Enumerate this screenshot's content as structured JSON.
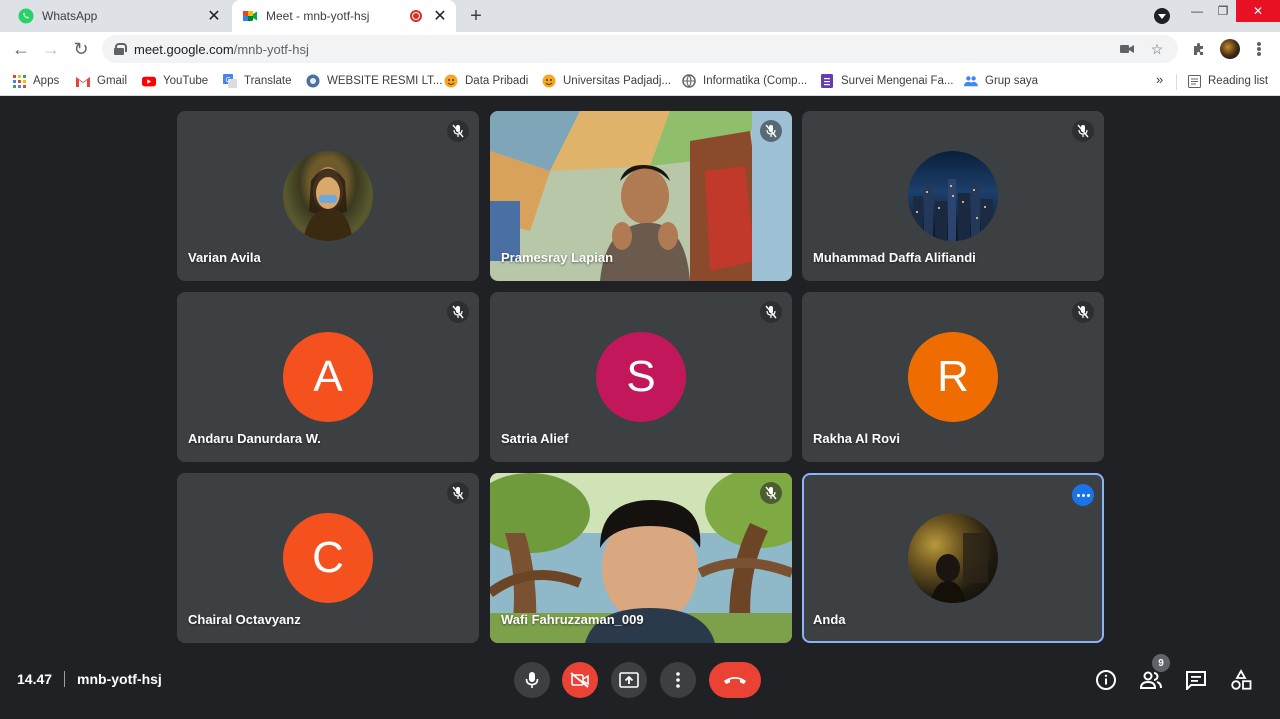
{
  "browser": {
    "tabs": [
      {
        "title": "WhatsApp",
        "icon": "whatsapp-icon",
        "active": false
      },
      {
        "title": "Meet - mnb-yotf-hsj",
        "icon": "google-meet-icon",
        "active": true,
        "recording": true
      }
    ],
    "url_host": "meet.google.com",
    "url_path": "/mnb-yotf-hsj",
    "bookmarks": [
      {
        "label": "Apps",
        "icon": "apps-grid-icon"
      },
      {
        "label": "Gmail",
        "icon": "gmail-icon"
      },
      {
        "label": "YouTube",
        "icon": "youtube-icon"
      },
      {
        "label": "Translate",
        "icon": "translate-icon"
      },
      {
        "label": "WEBSITE RESMI LT...",
        "icon": "globe-icon"
      },
      {
        "label": "Data Pribadi",
        "icon": "emoji-icon"
      },
      {
        "label": "Universitas Padjadj...",
        "icon": "emoji-icon"
      },
      {
        "label": "Informatika (Comp...",
        "icon": "globe-icon"
      },
      {
        "label": "Survei Mengenai Fa...",
        "icon": "forms-icon"
      },
      {
        "label": "Grup saya",
        "icon": "group-icon"
      }
    ],
    "more_bookmarks": "»",
    "reading_list": "Reading list"
  },
  "meet": {
    "time": "14.47",
    "meeting_code": "mnb-yotf-hsj",
    "participant_count": "9",
    "participants": [
      {
        "name": "Varian Avila",
        "type": "photo",
        "muted": true
      },
      {
        "name": "Pramesray Lapian",
        "type": "video",
        "muted": true
      },
      {
        "name": "Muhammad Daffa Alifiandi",
        "type": "photo",
        "muted": true
      },
      {
        "name": "Andaru Danurdara W.",
        "type": "initial",
        "initial": "A",
        "color": "#f4511e",
        "muted": true
      },
      {
        "name": "Satria Alief",
        "type": "initial",
        "initial": "S",
        "color": "#c2185b",
        "muted": true
      },
      {
        "name": "Rakha Al Rovi",
        "type": "initial",
        "initial": "R",
        "color": "#ef6c00",
        "muted": true
      },
      {
        "name": "Chairal Octavyanz",
        "type": "initial",
        "initial": "C",
        "color": "#f4511e",
        "muted": true
      },
      {
        "name": "Wafi Fahruzzaman_009",
        "type": "video",
        "muted": true
      },
      {
        "name": "Anda",
        "type": "photo",
        "muted": false,
        "self": true
      }
    ],
    "controls": [
      "mic-icon",
      "camera-off-icon",
      "present-screen-icon",
      "more-options-icon",
      "end-call-icon"
    ],
    "right_controls": [
      "info-icon",
      "people-icon",
      "chat-icon",
      "activities-icon"
    ]
  }
}
